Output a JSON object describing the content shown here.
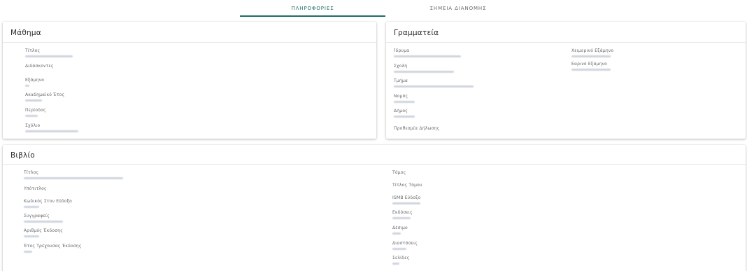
{
  "tabs": [
    {
      "label": "ΠΛΗΡΟΦΟΡΙΕΣ",
      "active": true
    },
    {
      "label": "ΣΗΜΕΙΑ ΔΙΑΝΟΜΗΣ",
      "active": false
    }
  ],
  "mathima": {
    "title": "Μάθημα",
    "fields": [
      {
        "label": "Τίτλος"
      },
      {
        "label": "Διδάσκοντες"
      },
      {
        "label": "Εξάμηνο"
      },
      {
        "label": "Ακαδημαϊκό Έτος"
      },
      {
        "label": "Περίοδος"
      },
      {
        "label": "Σχόλιο"
      }
    ]
  },
  "grammateia": {
    "title": "Γραμματεία",
    "fields_left": [
      {
        "label": "Ίδρυμα"
      },
      {
        "label": "Σχολή"
      },
      {
        "label": "Τμήμα"
      },
      {
        "label": "Νομός"
      },
      {
        "label": "Δήμος"
      },
      {
        "label": "Προθεσμία Δήλωσης"
      }
    ],
    "fields_right": [
      {
        "label": "Χειμερινό Εξάμηνο"
      },
      {
        "label": "Εαρινό Εξάμηνο"
      }
    ]
  },
  "vivlio": {
    "title": "Βιβλίο",
    "fields_left": [
      {
        "label": "Τίτλος"
      },
      {
        "label": "Υπότιτλος"
      },
      {
        "label": "Κωδικός Στον Εύδοξο"
      },
      {
        "label": "Συγγραφείς"
      },
      {
        "label": "Αριθμός Έκδοσης"
      },
      {
        "label": "Έτος Τρέχουσας Έκδοσης"
      }
    ],
    "fields_right": [
      {
        "label": "Τόμος"
      },
      {
        "label": "Τίτλος Τόμου"
      },
      {
        "label": "ISMB Εύδοξο"
      },
      {
        "label": "Εκδόσεις"
      },
      {
        "label": "Δέσιμο"
      },
      {
        "label": "Διαστάσεις"
      },
      {
        "label": "Σελίδες"
      }
    ]
  }
}
